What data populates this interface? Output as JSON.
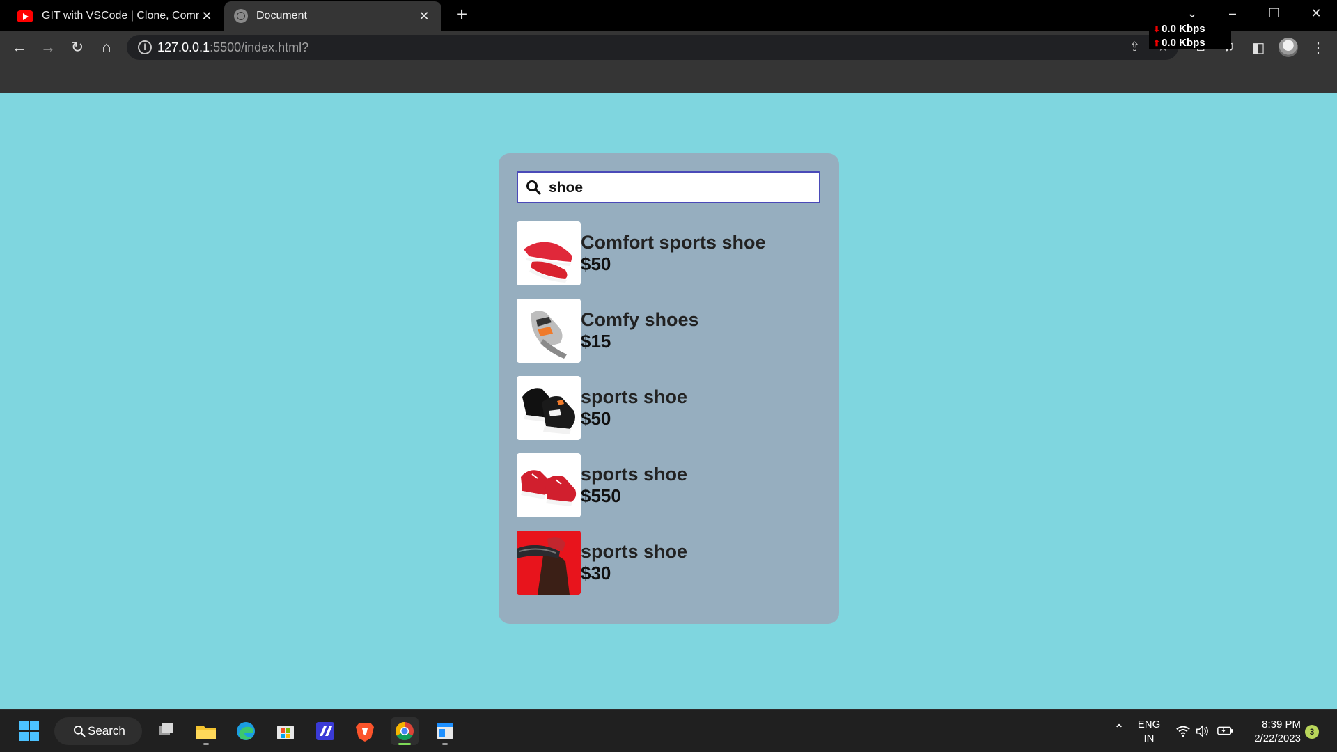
{
  "browser": {
    "tabs": [
      {
        "title": "GIT with VSCode | Clone, Commit",
        "icon": "youtube-icon",
        "active": false
      },
      {
        "title": "Document",
        "icon": "globe-icon",
        "active": true
      }
    ],
    "address": {
      "host": "127.0.0.1",
      "rest": ":5500/index.html?"
    },
    "net_speed": {
      "down": "0.0 Kbps",
      "up": "0.0 Kbps"
    }
  },
  "search": {
    "value": "shoe",
    "icon": "search-icon"
  },
  "results": [
    {
      "name": "Comfort sports shoe",
      "price": "$50",
      "image": "red-running-shoe"
    },
    {
      "name": "Comfy shoes",
      "price": "$15",
      "image": "grey-orange-sneaker"
    },
    {
      "name": "sports shoe",
      "price": "$50",
      "image": "black-white-sneaker"
    },
    {
      "name": "sports shoe",
      "price": "$550",
      "image": "red-canvas-sneaker"
    },
    {
      "name": "sports shoe",
      "price": "$30",
      "image": "person-with-shoe-red-background"
    }
  ],
  "taskbar": {
    "search_label": "Search",
    "language": {
      "line1": "ENG",
      "line2": "IN"
    },
    "time": "8:39 PM",
    "date": "2/22/2023",
    "notification_count": "3"
  },
  "colors": {
    "page_bg": "#7fd6df",
    "card_bg": "#96aebf",
    "search_border": "#4a4ab8"
  }
}
